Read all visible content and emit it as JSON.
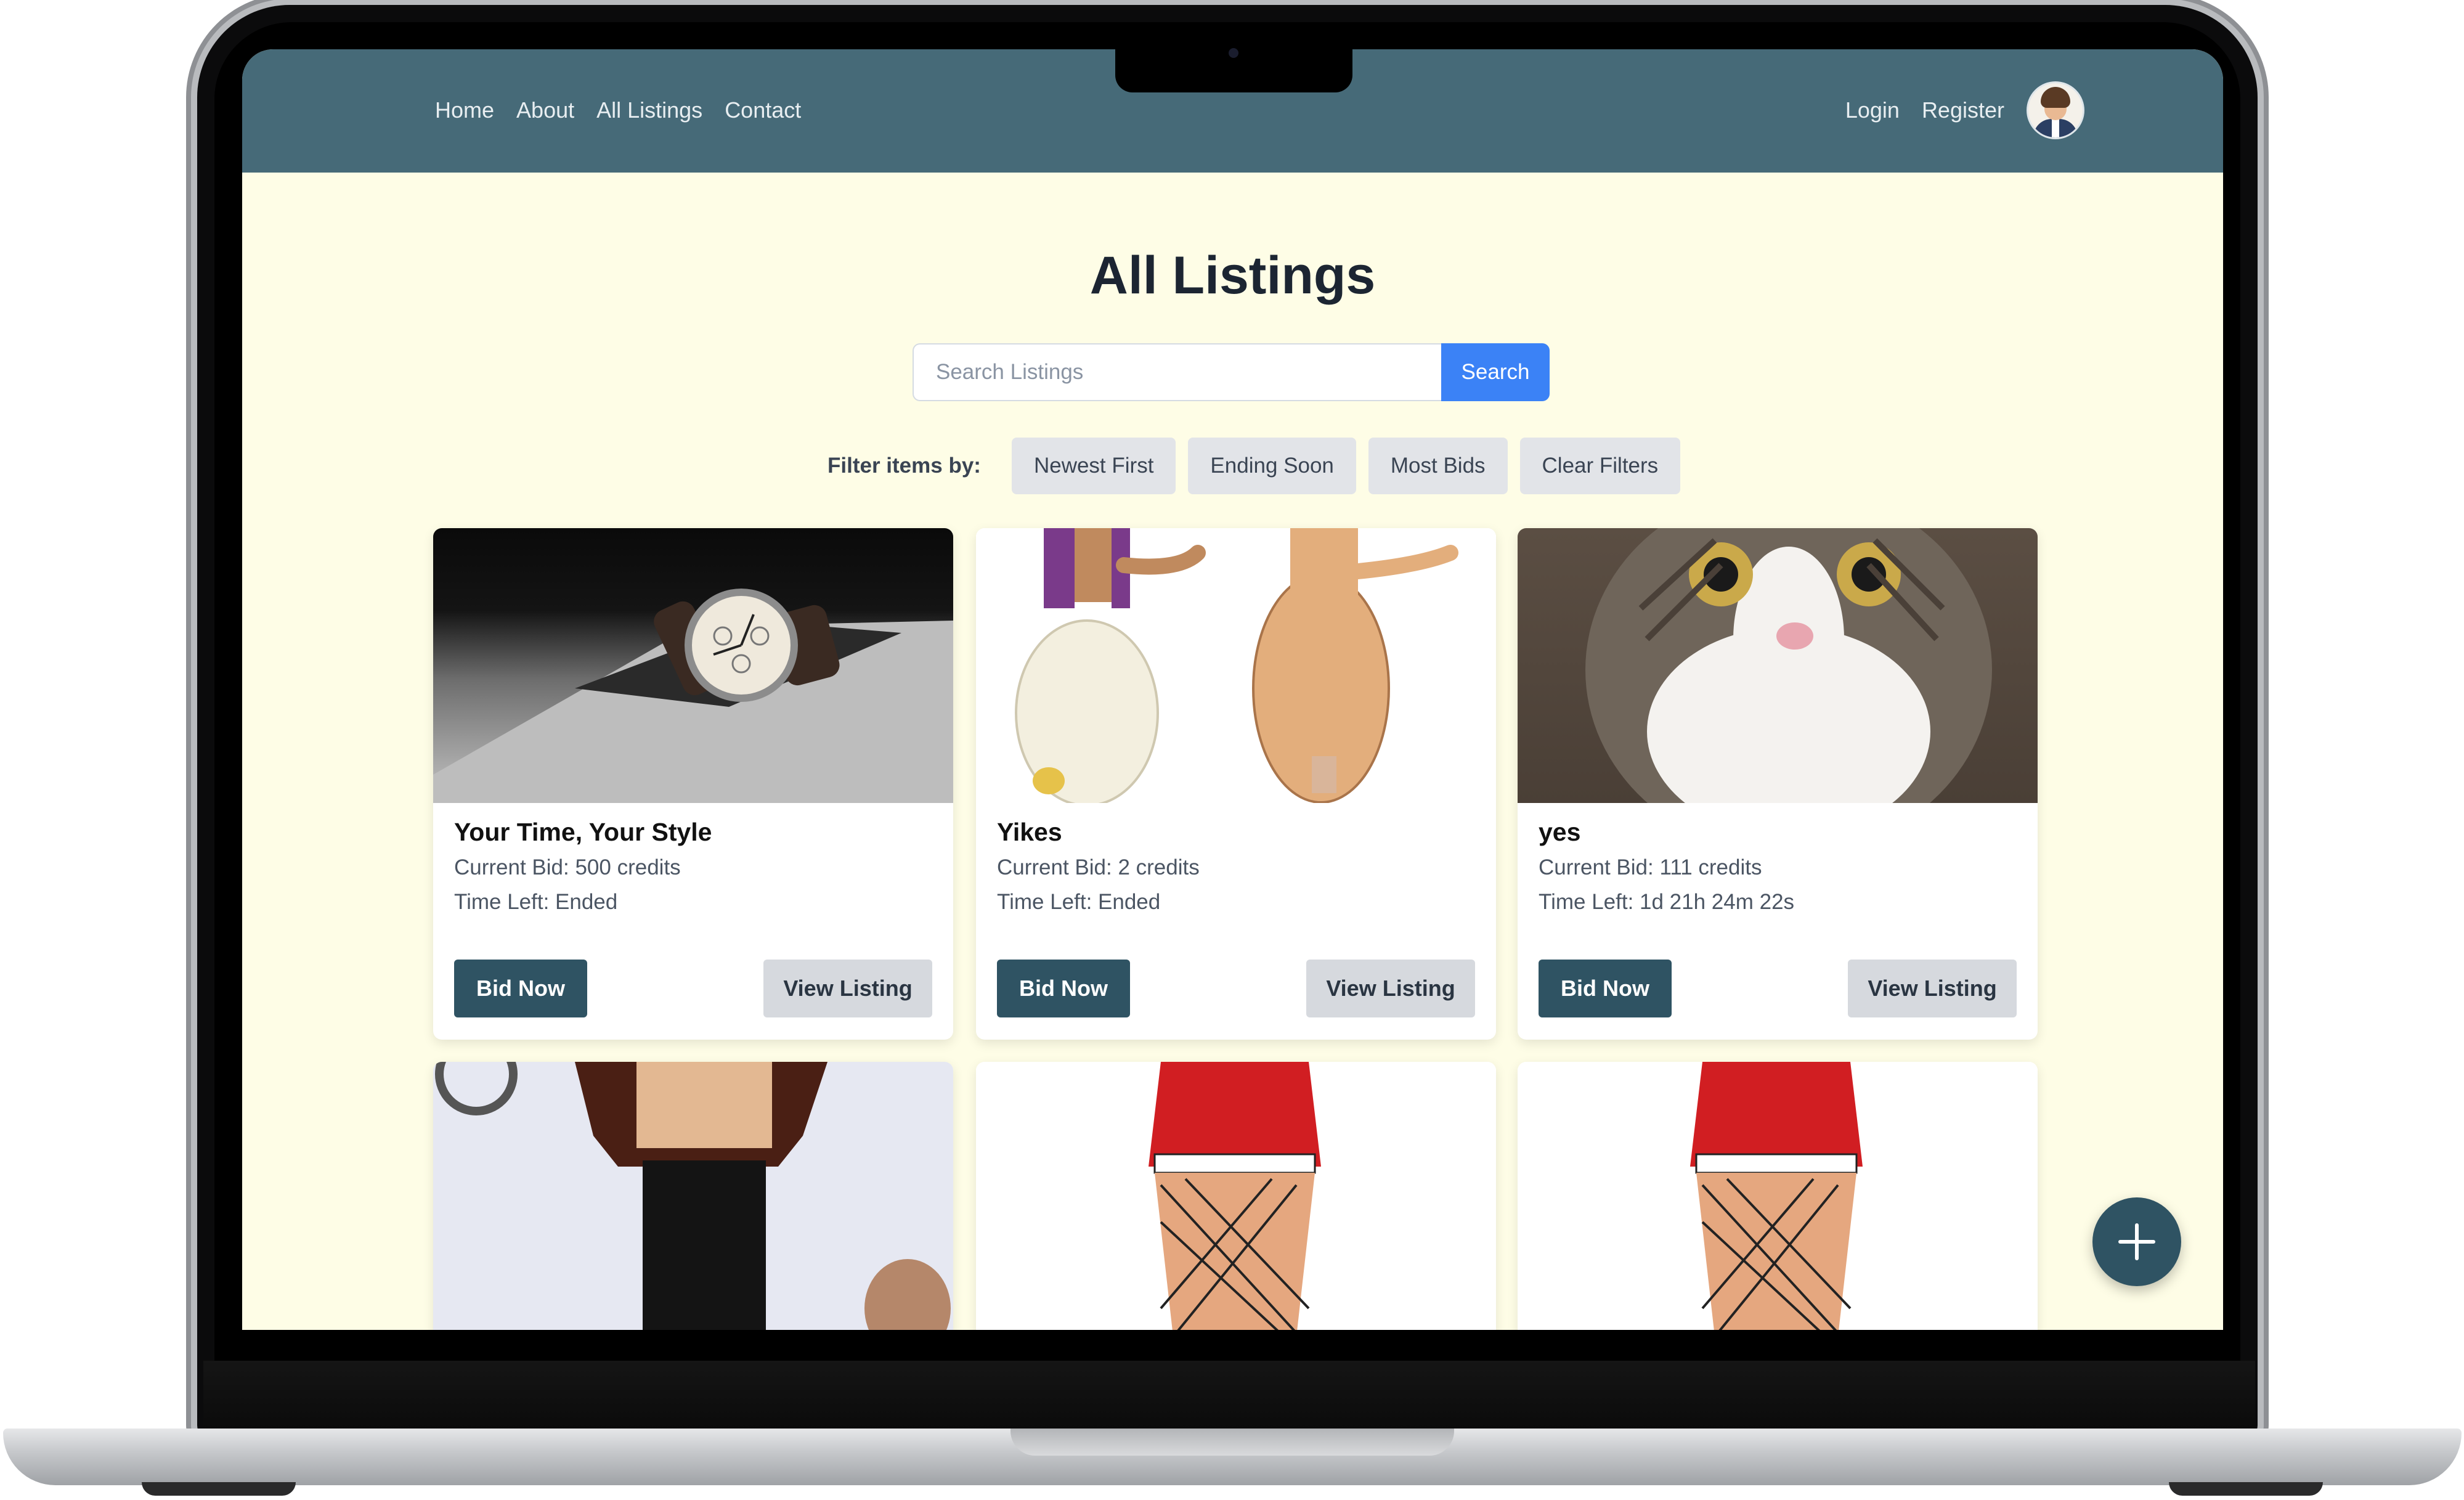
{
  "nav": {
    "links": [
      "Home",
      "About",
      "All Listings",
      "Contact"
    ],
    "login": "Login",
    "register": "Register"
  },
  "page": {
    "title": "All Listings"
  },
  "search": {
    "placeholder": "Search Listings",
    "button": "Search"
  },
  "filters": {
    "label": "Filter items by:",
    "options": [
      "Newest First",
      "Ending Soon",
      "Most Bids",
      "Clear Filters"
    ]
  },
  "listings": [
    {
      "title": "Your Time, Your Style",
      "current_bid": "Current Bid: 500 credits",
      "time_left": "Time Left: Ended",
      "image": "wristwatch-photo",
      "bid_label": "Bid Now",
      "view_label": "View Listing"
    },
    {
      "title": "Yikes",
      "current_bid": "Current Bid: 2 credits",
      "time_left": "Time Left: Ended",
      "image": "cartoon-figure-illustration",
      "bid_label": "Bid Now",
      "view_label": "View Listing"
    },
    {
      "title": "yes",
      "current_bid": "Current Bid: 111 credits",
      "time_left": "Time Left: 1d 21h 24m 22s",
      "image": "cat-photo",
      "bid_label": "Bid Now",
      "view_label": "View Listing"
    },
    {
      "image": "cartoon-character-illustration"
    },
    {
      "image": "cartoon-red-costume-illustration"
    },
    {
      "image": "cartoon-red-costume-illustration"
    }
  ],
  "colors": {
    "header": "#466a78",
    "page_background": "#fefde6",
    "primary_button": "#2f5363",
    "search_button": "#3b82f6",
    "secondary_button": "#d6d9de"
  },
  "fab": {
    "icon": "plus-icon"
  }
}
